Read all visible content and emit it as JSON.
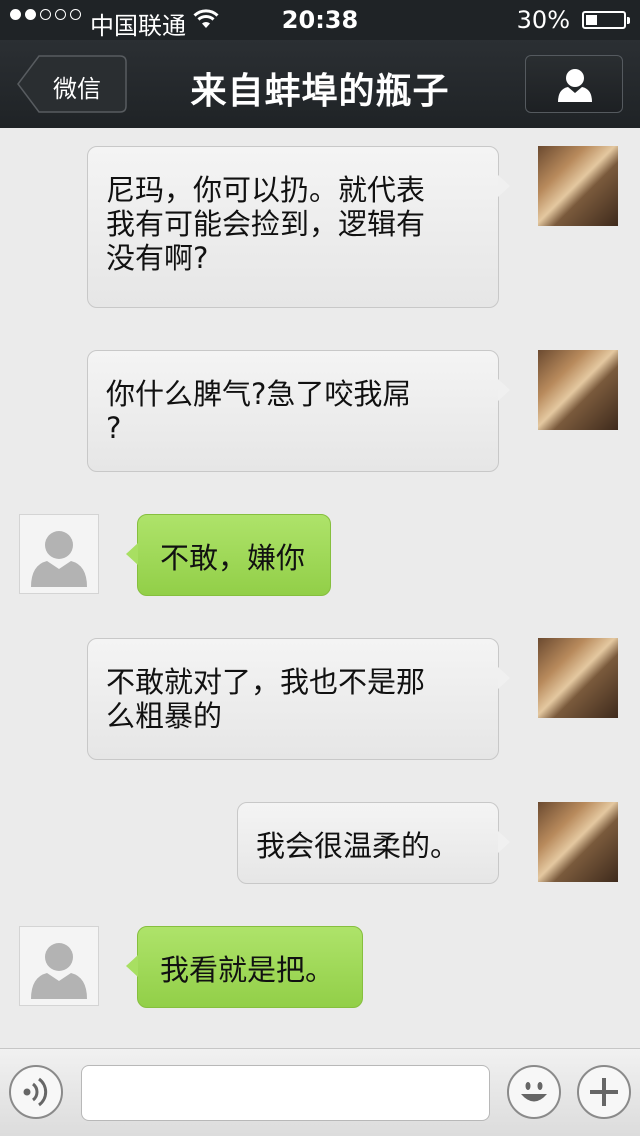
{
  "status_bar": {
    "carrier": "中国联通",
    "time": "20:38",
    "battery_text": "30%",
    "battery_level": 0.3,
    "signal_bars_filled": 2,
    "signal_bars_total": 5,
    "icons": [
      "signal-dots-icon",
      "wifi-icon",
      "battery-icon"
    ]
  },
  "nav": {
    "back_label": "微信",
    "title": "来自蚌埠的瓶子",
    "right_icon": "person-icon"
  },
  "messages": [
    {
      "side": "right",
      "sender_avatar": "kangaroo-photo",
      "text": "尼玛，你可以扔。就代表\n我有可能会捡到，逻辑有\n没有啊?"
    },
    {
      "side": "right",
      "sender_avatar": "kangaroo-photo",
      "text": "你什么脾气?急了咬我屌\n?"
    },
    {
      "side": "left",
      "sender_avatar": "default-person",
      "text": "不敢，嫌你"
    },
    {
      "side": "right",
      "sender_avatar": "kangaroo-photo",
      "text": "不敢就对了，我也不是那\n么粗暴的"
    },
    {
      "side": "right",
      "sender_avatar": "kangaroo-photo",
      "text": "我会很温柔的。"
    },
    {
      "side": "left",
      "sender_avatar": "default-person",
      "text": "我看就是把。"
    }
  ],
  "input_bar": {
    "text_value": "",
    "left_icon": "voice-icon",
    "right_icons": [
      "emoji-icon",
      "plus-icon"
    ]
  },
  "colors": {
    "nav_bg": "#1f2326",
    "chat_bg": "#ebebeb",
    "sent_bubble": "#f0f0f0",
    "received_bubble": "#9fd858"
  }
}
